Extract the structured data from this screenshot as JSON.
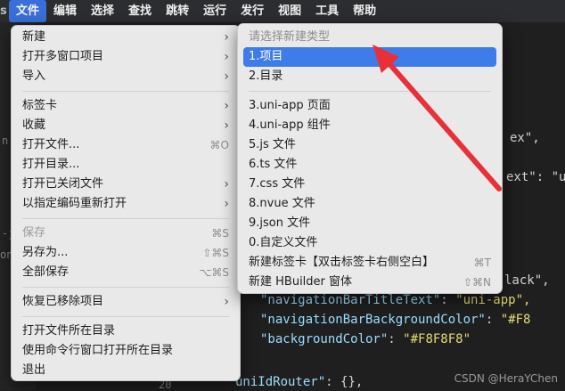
{
  "menubar": {
    "items": [
      {
        "label": "文件",
        "active": true
      },
      {
        "label": "编辑"
      },
      {
        "label": "选择"
      },
      {
        "label": "查找"
      },
      {
        "label": "跳转"
      },
      {
        "label": "运行"
      },
      {
        "label": "发行"
      },
      {
        "label": "视图"
      },
      {
        "label": "工具"
      },
      {
        "label": "帮助"
      }
    ]
  },
  "file_menu": {
    "items": [
      {
        "label": "新建",
        "submenu": true
      },
      {
        "label": "打开多窗口项目",
        "submenu": true
      },
      {
        "label": "导入",
        "submenu": true
      },
      {
        "label": "标签卡",
        "submenu": true
      },
      {
        "label": "收藏",
        "submenu": true
      },
      {
        "label": "打开文件...",
        "shortcut": "⌘O"
      },
      {
        "label": "打开目录..."
      },
      {
        "label": "打开已关闭文件",
        "submenu": true
      },
      {
        "label": "以指定编码重新打开",
        "submenu": true
      },
      {
        "label": "保存",
        "shortcut": "⌘S",
        "disabled": true
      },
      {
        "label": "另存为...",
        "shortcut": "⇧⌘S"
      },
      {
        "label": "全部保存",
        "shortcut": "⌥⌘S"
      },
      {
        "label": "恢复已移除项目",
        "submenu": true
      },
      {
        "label": "打开文件所在目录"
      },
      {
        "label": "使用命令行窗口打开所在目录"
      },
      {
        "label": "退出"
      }
    ]
  },
  "new_submenu": {
    "header": "请选择新建类型",
    "items": [
      {
        "label": "1.项目",
        "highlighted": true
      },
      {
        "label": "2.目录"
      },
      {
        "label": "3.uni-app 页面"
      },
      {
        "label": "4.uni-app 组件"
      },
      {
        "label": "5.js 文件"
      },
      {
        "label": "6.ts 文件"
      },
      {
        "label": "7.css 文件"
      },
      {
        "label": "8.nvue 文件"
      },
      {
        "label": "9.json 文件"
      },
      {
        "label": "0.自定义文件"
      },
      {
        "label": "新建标签卡【双击标签卡右侧空白】",
        "shortcut": "⌘T"
      },
      {
        "label": "新建 HBuilder 窗体",
        "shortcut": "⇧⌘N"
      }
    ]
  },
  "editor": {
    "lines": [
      {
        "key": "",
        "text": "ex\","
      },
      {
        "key": "",
        "text": "ext\": \"u"
      },
      {
        "key": "",
        "text": "lack\","
      },
      {
        "key": "\"navigationBarTitleText\"",
        "value": "\"uni-app\","
      },
      {
        "key": "\"navigationBarBackgroundColor\"",
        "value": "\"#F8"
      },
      {
        "key": "\"backgroundColor\"",
        "value": "\"#F8F8F8\""
      },
      {
        "key": "uniIdRouter\"",
        "value": "{},"
      }
    ],
    "gutter_fragments": [
      "n",
      "-j",
      "on",
      "20"
    ]
  },
  "watermark": "CSDN @HeraYChen",
  "colors": {
    "highlight": "#3e7ce9",
    "annotation_arrow": "#e8303a"
  }
}
